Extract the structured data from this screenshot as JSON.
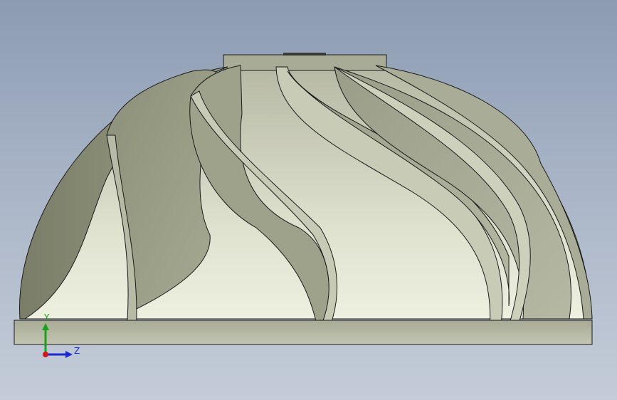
{
  "viewport": {
    "background_top": "#8c9bb2",
    "background_bottom": "#c4ccd8"
  },
  "model": {
    "part": "impeller",
    "blade_count_visible": 6,
    "surface_color": "#8e927c",
    "highlight_color": "#e6e8d6",
    "edge_color": "#1a1a1a"
  },
  "triad": {
    "y_label": "Y",
    "z_label": "Z",
    "y_color": "#1aa01a",
    "z_color": "#1a2ad0",
    "x_color": "#d01a1a",
    "x_dot_icon": "origin-dot-icon"
  }
}
